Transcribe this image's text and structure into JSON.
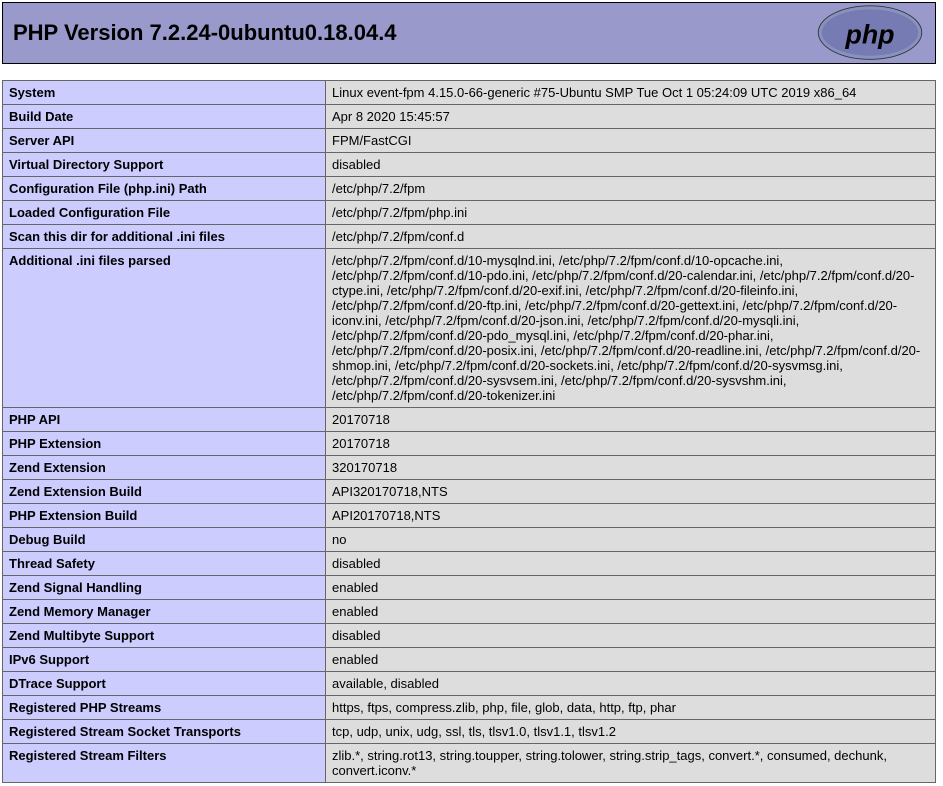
{
  "header": {
    "title": "PHP Version 7.2.24-0ubuntu0.18.04.4"
  },
  "info": [
    {
      "label": "System",
      "value": "Linux event-fpm 4.15.0-66-generic #75-Ubuntu SMP Tue Oct 1 05:24:09 UTC 2019 x86_64"
    },
    {
      "label": "Build Date",
      "value": "Apr 8 2020 15:45:57"
    },
    {
      "label": "Server API",
      "value": "FPM/FastCGI"
    },
    {
      "label": "Virtual Directory Support",
      "value": "disabled"
    },
    {
      "label": "Configuration File (php.ini) Path",
      "value": "/etc/php/7.2/fpm"
    },
    {
      "label": "Loaded Configuration File",
      "value": "/etc/php/7.2/fpm/php.ini"
    },
    {
      "label": "Scan this dir for additional .ini files",
      "value": "/etc/php/7.2/fpm/conf.d"
    },
    {
      "label": "Additional .ini files parsed",
      "value": "/etc/php/7.2/fpm/conf.d/10-mysqlnd.ini, /etc/php/7.2/fpm/conf.d/10-opcache.ini, /etc/php/7.2/fpm/conf.d/10-pdo.ini, /etc/php/7.2/fpm/conf.d/20-calendar.ini, /etc/php/7.2/fpm/conf.d/20-ctype.ini, /etc/php/7.2/fpm/conf.d/20-exif.ini, /etc/php/7.2/fpm/conf.d/20-fileinfo.ini, /etc/php/7.2/fpm/conf.d/20-ftp.ini, /etc/php/7.2/fpm/conf.d/20-gettext.ini, /etc/php/7.2/fpm/conf.d/20-iconv.ini, /etc/php/7.2/fpm/conf.d/20-json.ini, /etc/php/7.2/fpm/conf.d/20-mysqli.ini, /etc/php/7.2/fpm/conf.d/20-pdo_mysql.ini, /etc/php/7.2/fpm/conf.d/20-phar.ini, /etc/php/7.2/fpm/conf.d/20-posix.ini, /etc/php/7.2/fpm/conf.d/20-readline.ini, /etc/php/7.2/fpm/conf.d/20-shmop.ini, /etc/php/7.2/fpm/conf.d/20-sockets.ini, /etc/php/7.2/fpm/conf.d/20-sysvmsg.ini, /etc/php/7.2/fpm/conf.d/20-sysvsem.ini, /etc/php/7.2/fpm/conf.d/20-sysvshm.ini, /etc/php/7.2/fpm/conf.d/20-tokenizer.ini"
    },
    {
      "label": "PHP API",
      "value": "20170718"
    },
    {
      "label": "PHP Extension",
      "value": "20170718"
    },
    {
      "label": "Zend Extension",
      "value": "320170718"
    },
    {
      "label": "Zend Extension Build",
      "value": "API320170718,NTS"
    },
    {
      "label": "PHP Extension Build",
      "value": "API20170718,NTS"
    },
    {
      "label": "Debug Build",
      "value": "no"
    },
    {
      "label": "Thread Safety",
      "value": "disabled"
    },
    {
      "label": "Zend Signal Handling",
      "value": "enabled"
    },
    {
      "label": "Zend Memory Manager",
      "value": "enabled"
    },
    {
      "label": "Zend Multibyte Support",
      "value": "disabled"
    },
    {
      "label": "IPv6 Support",
      "value": "enabled"
    },
    {
      "label": "DTrace Support",
      "value": "available, disabled"
    },
    {
      "label": "Registered PHP Streams",
      "value": "https, ftps, compress.zlib, php, file, glob, data, http, ftp, phar"
    },
    {
      "label": "Registered Stream Socket Transports",
      "value": "tcp, udp, unix, udg, ssl, tls, tlsv1.0, tlsv1.1, tlsv1.2"
    },
    {
      "label": "Registered Stream Filters",
      "value": "zlib.*, string.rot13, string.toupper, string.tolower, string.strip_tags, convert.*, consumed, dechunk, convert.iconv.*"
    }
  ]
}
